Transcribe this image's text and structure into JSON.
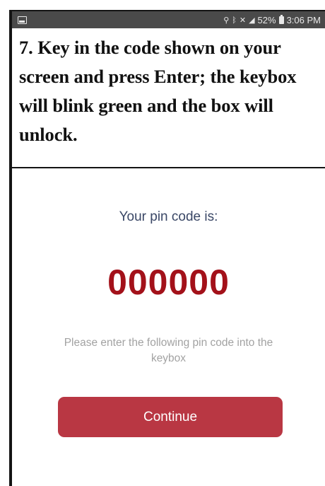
{
  "status_bar": {
    "icons": [
      "picture-notification-icon",
      "location-icon",
      "bluetooth-icon",
      "mute-icon",
      "signal-icon",
      "battery-icon"
    ],
    "battery": "52%",
    "time": "3:06 PM"
  },
  "instruction": {
    "text": "7. Key in the code shown on your screen and press Enter; the keybox will blink green and the box will unlock."
  },
  "pin": {
    "label": "Your pin code is:",
    "code": "000000",
    "instructions": "Please enter the following pin code into the keybox"
  },
  "actions": {
    "continue_label": "Continue"
  },
  "colors": {
    "status_bar": "#4a4a4a",
    "pin_label": "#3a4766",
    "pin_code": "#a3111a",
    "instructions_text": "#a2a2a2",
    "button": "#b93743"
  }
}
